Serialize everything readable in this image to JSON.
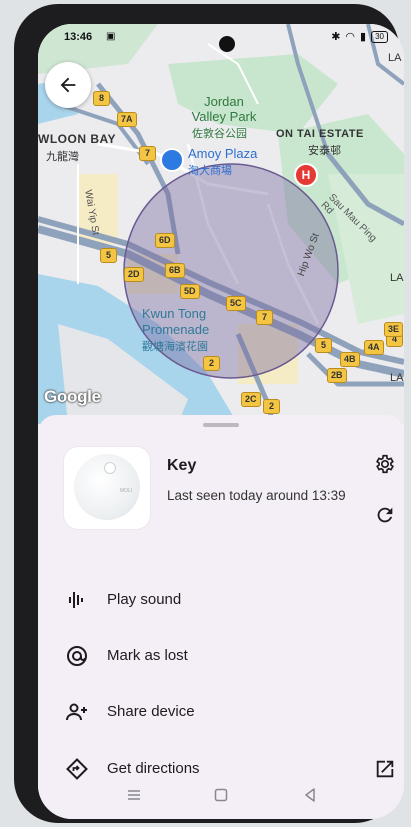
{
  "status_bar": {
    "time": "13:46",
    "battery": "30"
  },
  "map": {
    "labels": {
      "jordan_valley": "Jordan\nValley Park",
      "jordan_valley_cn": "佐敦谷公园",
      "amoy_plaza": "Amoy Plaza",
      "amoy_plaza_cn": "淘大商場",
      "on_tai": "ON TAI ESTATE",
      "on_tai_cn": "安泰邨",
      "kowloon_bay": "WLOON BAY",
      "kowloon_bay_cn": "九龍灣",
      "wai_yip": "Wai Yip St",
      "sau_mau_ping": "Sau Mau Ping Rd",
      "hip_wo": "Hip Wo St",
      "kwun_tong_prom": "Kwun Tong",
      "kwun_tong_prom2": "Promenade",
      "kwun_tong_prom_cn": "觀塘海濱花園",
      "la_top": "LA",
      "la_mid": "LA",
      "la_bot": "LA"
    },
    "route_markers": [
      "8",
      "7A",
      "7",
      "6D",
      "5",
      "6B",
      "2D",
      "5D",
      "5C",
      "7",
      "2",
      "5",
      "4B",
      "4A",
      "4",
      "3E",
      "2B",
      "2C",
      "2"
    ],
    "google_logo": "Google"
  },
  "sheet": {
    "device_name": "Key",
    "last_seen": "Last seen today around 13:39",
    "tag_brand": "MOLI",
    "actions": [
      {
        "label": "Play sound",
        "icon": "sound-wave-icon"
      },
      {
        "label": "Mark as lost",
        "icon": "lost-at-icon"
      },
      {
        "label": "Share device",
        "icon": "share-person-icon"
      },
      {
        "label": "Get directions",
        "icon": "directions-icon"
      }
    ]
  },
  "colors": {
    "accent_circle": "#7a6aa0",
    "sheet_bg": "#f4eff6",
    "road": "#8e9fb5",
    "water": "#a8d4ea",
    "park": "#bfe2c8"
  }
}
